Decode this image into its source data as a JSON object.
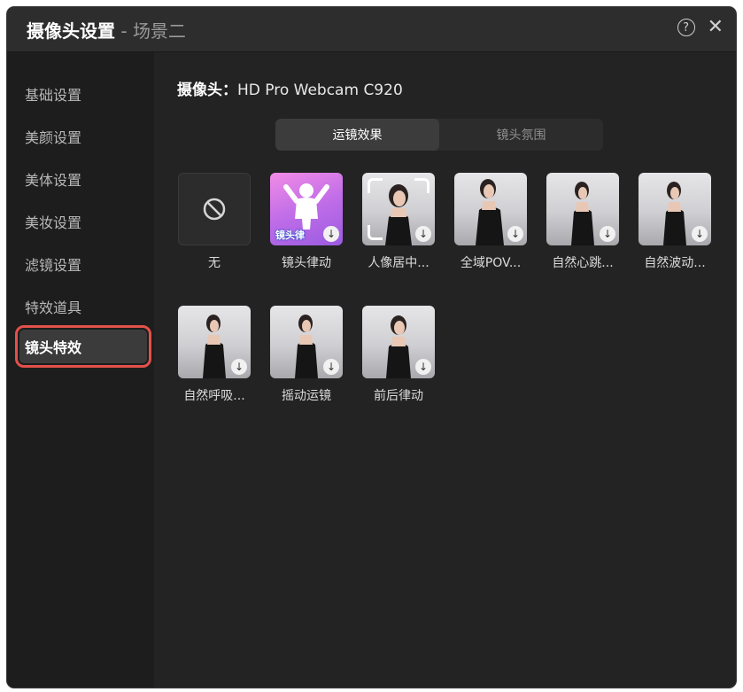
{
  "window": {
    "title": "摄像头设置",
    "title_separator": " - ",
    "scene": "场景二",
    "help_icon": "?",
    "close_icon": "✕"
  },
  "sidebar": {
    "items": [
      {
        "label": "基础设置",
        "active": false
      },
      {
        "label": "美颜设置",
        "active": false
      },
      {
        "label": "美体设置",
        "active": false
      },
      {
        "label": "美妆设置",
        "active": false
      },
      {
        "label": "滤镜设置",
        "active": false
      },
      {
        "label": "特效道具",
        "active": false
      },
      {
        "label": "镜头特效",
        "active": true
      }
    ]
  },
  "main": {
    "camera_key": "摄像头：",
    "camera_name": "HD Pro Webcam C920",
    "tabs": [
      {
        "label": "运镜效果",
        "active": true
      },
      {
        "label": "镜头氛围",
        "active": false
      }
    ],
    "effects": [
      {
        "label": "无",
        "kind": "none"
      },
      {
        "label": "镜头律动",
        "kind": "pink",
        "badge": "镜头律"
      },
      {
        "label": "人像居中...",
        "kind": "frame"
      },
      {
        "label": "全域POV...",
        "kind": "photo"
      },
      {
        "label": "自然心跳...",
        "kind": "photo"
      },
      {
        "label": "自然波动...",
        "kind": "photo"
      },
      {
        "label": "自然呼吸...",
        "kind": "photo"
      },
      {
        "label": "摇动运镜",
        "kind": "photo"
      },
      {
        "label": "前后律动",
        "kind": "photo"
      }
    ],
    "download_icon": "↓"
  },
  "colors": {
    "window_bg": "#232323",
    "sidebar_bg": "#1d1d1d",
    "highlight": "#e2514a"
  }
}
